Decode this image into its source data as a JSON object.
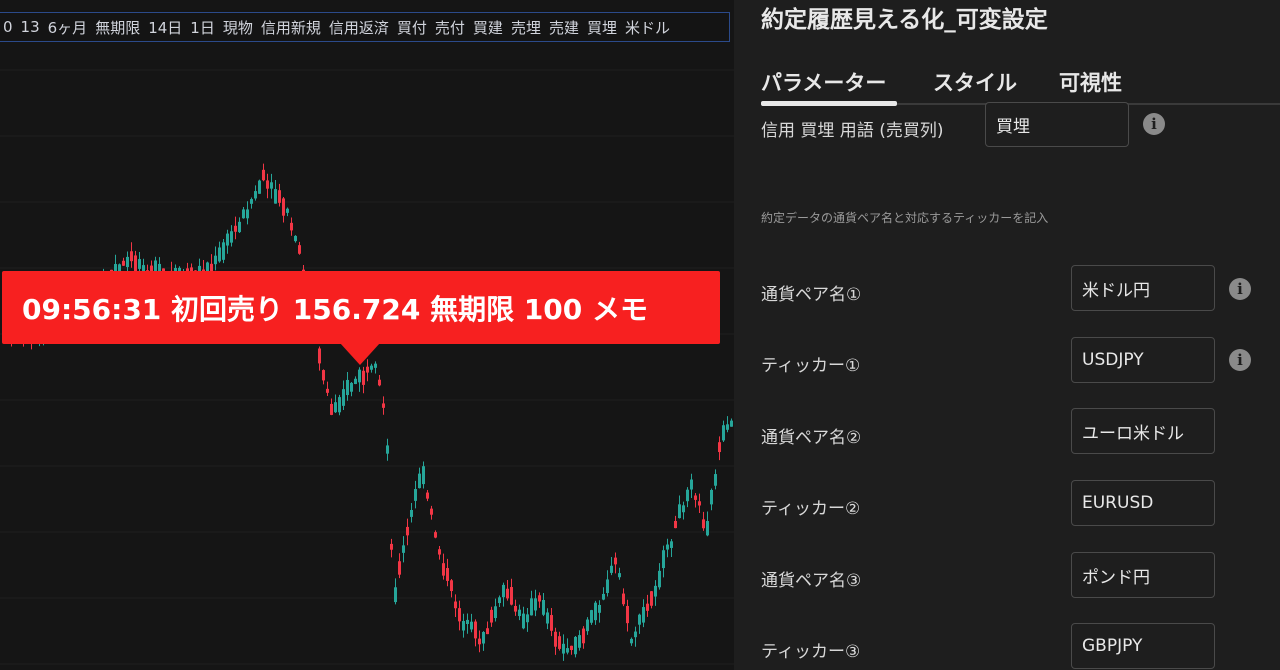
{
  "toolbar": {
    "items": [
      "0",
      "13",
      "6ヶ月",
      "無期限",
      "14日",
      "1日",
      "現物",
      "信用新規",
      "信用返済",
      "買付",
      "売付",
      "買建",
      "売埋",
      "売建",
      "買埋",
      "米ドル"
    ]
  },
  "tooltip": {
    "text": "09:56:31 初回売り 156.724 無期限 100 メモ"
  },
  "colors": {
    "up": "#26a69a",
    "down": "#f23645",
    "tooltip": "#f72020"
  },
  "panel": {
    "title": "約定履歴見える化_可変設定",
    "tabs": [
      "パラメーター",
      "スタイル",
      "可視性"
    ],
    "active_tab": "パラメーター",
    "top_row": {
      "label": "信用 買埋 用語 (売買列)",
      "value": "買埋"
    },
    "description": "約定データの通貨ペア名と対応するティッカーを記入",
    "rows": [
      {
        "label": "通貨ペア名①",
        "value": "米ドル円"
      },
      {
        "label": "ティッカー①",
        "value": "USDJPY"
      },
      {
        "label": "通貨ペア名②",
        "value": "ユーロ米ドル"
      },
      {
        "label": "ティッカー②",
        "value": "EURUSD"
      },
      {
        "label": "通貨ペア名③",
        "value": "ポンド円"
      },
      {
        "label": "ティッカー③",
        "value": "GBPJPY"
      }
    ],
    "info_icon": "info-icon"
  }
}
